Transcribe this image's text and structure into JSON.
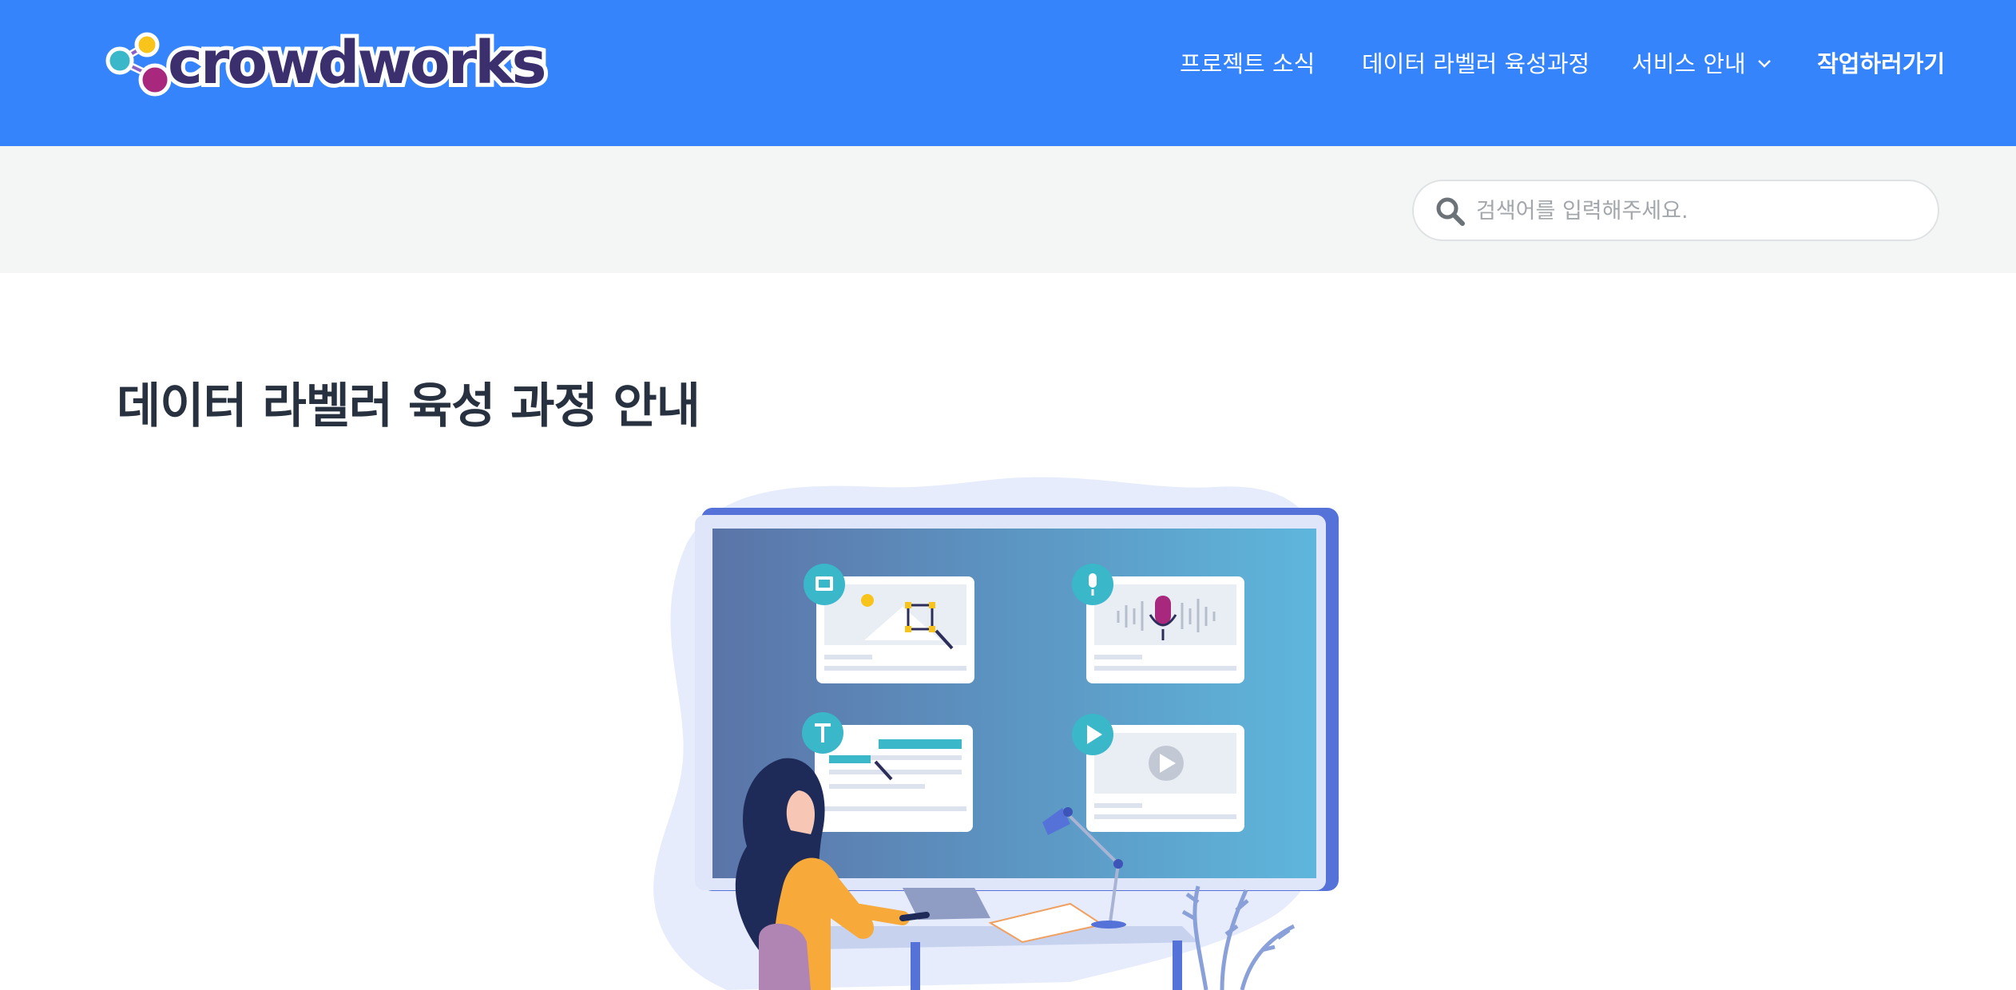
{
  "brand": {
    "logo_text": "crowdworks"
  },
  "nav": {
    "items": [
      {
        "label": "프로젝트 소식"
      },
      {
        "label": "데이터 라벨러 육성과정"
      },
      {
        "label": "서비스 안내"
      },
      {
        "label": "작업하러가기"
      }
    ]
  },
  "search": {
    "placeholder": "검색어를 입력해주세요.",
    "value": ""
  },
  "main": {
    "title": "데이터 라벨러 육성 과정 안내"
  },
  "icons": {
    "search": "search-icon",
    "dropdown": "chevron-down-icon",
    "image": "image-icon",
    "mic": "microphone-icon",
    "text": "text-icon",
    "play": "play-icon"
  },
  "colors": {
    "header_bg": "#3584fc",
    "search_band_bg": "#f4f5f5",
    "title": "#27313f",
    "accent_teal": "#3ab7c9",
    "logo_dark": "#3b2f6e"
  }
}
